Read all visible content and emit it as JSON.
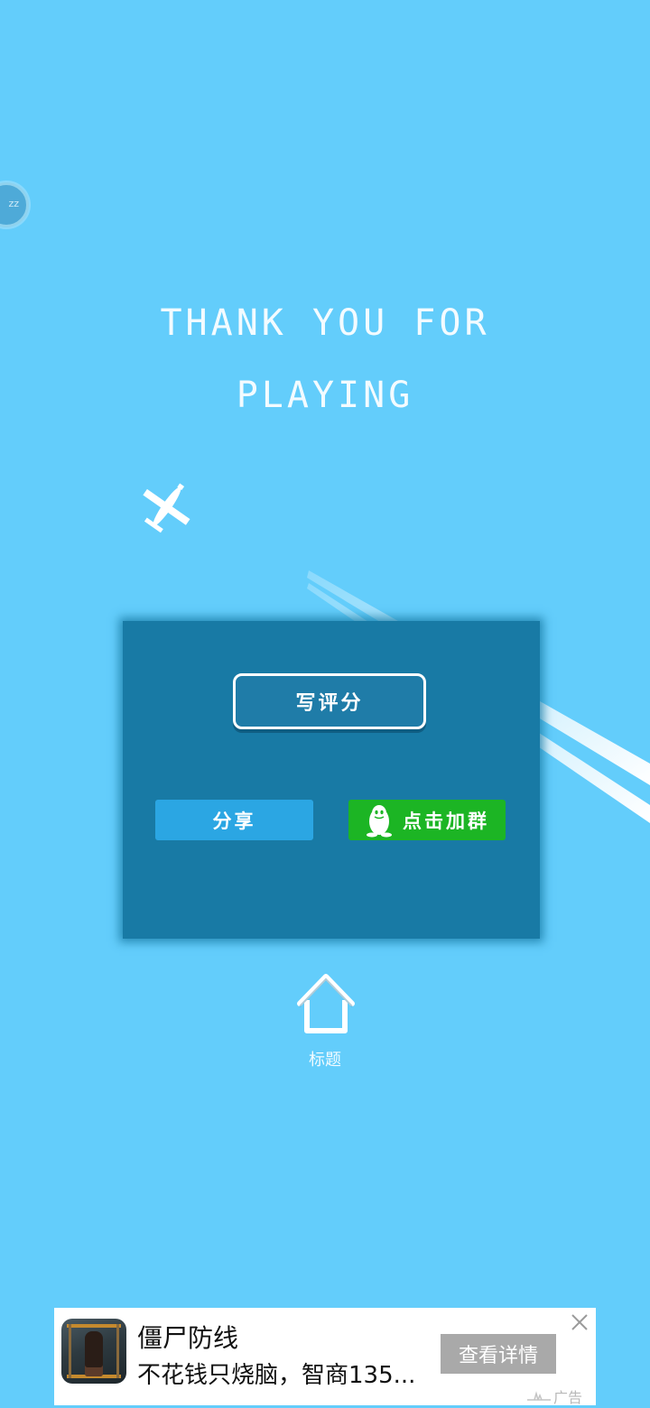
{
  "side_bubble": {
    "text": "zz"
  },
  "headline": {
    "line1": "THANK YOU FOR",
    "line2": "PLAYING"
  },
  "panel": {
    "rate_label": "写评分",
    "share_label": "分享",
    "join_group_label": "点击加群"
  },
  "home": {
    "label": "标题"
  },
  "ad": {
    "title": "僵尸防线",
    "description": "不花钱只烧脑，智商135...",
    "cta": "查看详情",
    "tag": "广告"
  },
  "icons": {
    "plane": "airplane-icon",
    "qq": "penguin-icon",
    "home": "house-icon",
    "close": "close-icon"
  },
  "colors": {
    "background": "#63cdfb",
    "panel": "#187aa5",
    "share": "#2ba6e3",
    "join_group": "#1cb524",
    "ad_cta": "#a9a9a9"
  }
}
